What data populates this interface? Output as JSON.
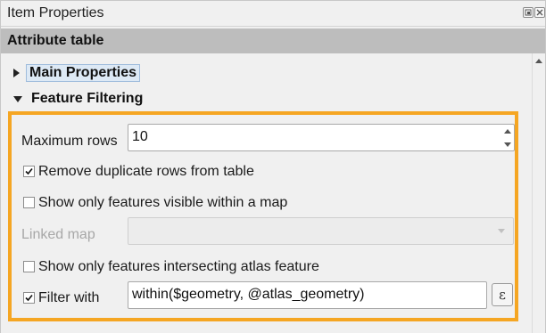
{
  "window": {
    "title": "Item Properties"
  },
  "header": {
    "title": "Attribute table"
  },
  "groups": {
    "main_properties": {
      "label": "Main Properties",
      "expanded": false
    },
    "feature_filtering": {
      "label": "Feature Filtering",
      "expanded": true
    }
  },
  "form": {
    "maximum_rows": {
      "label": "Maximum rows",
      "value": "10"
    },
    "remove_duplicates": {
      "label": "Remove duplicate rows from table",
      "checked": true
    },
    "visible_within_map": {
      "label": "Show only features visible within a map",
      "checked": false
    },
    "linked_map": {
      "label": "Linked map",
      "value": "",
      "enabled": false
    },
    "intersecting_atlas": {
      "label": "Show only features intersecting atlas feature",
      "checked": false
    },
    "filter_with": {
      "label": "Filter with",
      "checked": true,
      "expression": "within($geometry, @atlas_geometry)",
      "button_glyph": "ε"
    }
  },
  "colors": {
    "highlight": "#f5a623",
    "header_bg": "#bdbdbd",
    "panel_bg": "#f0f0f0"
  },
  "icons": [
    "float-icon",
    "close-icon",
    "expand-arrow-icon",
    "collapse-arrow-icon",
    "checkmark-icon",
    "spin-up-icon",
    "spin-down-icon",
    "dropdown-arrow-icon",
    "expression-icon"
  ]
}
